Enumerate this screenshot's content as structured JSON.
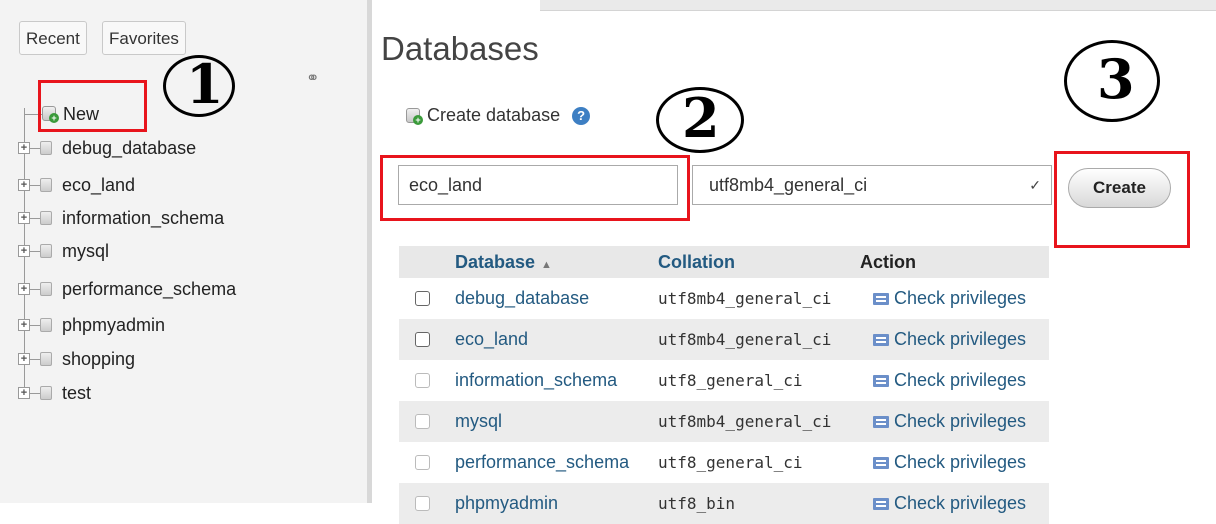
{
  "sidebar": {
    "tabs": [
      "Recent",
      "Favorites"
    ],
    "new_label": "New",
    "databases": [
      "debug_database",
      "eco_land",
      "information_schema",
      "mysql",
      "performance_schema",
      "phpmyadmin",
      "shopping",
      "test"
    ]
  },
  "annotations": [
    "1",
    "2",
    "3"
  ],
  "main": {
    "title": "Databases",
    "create_label": "Create database",
    "db_name_value": "eco_land",
    "collation_value": "utf8mb4_general_ci",
    "create_button": "Create",
    "table": {
      "headers": [
        "Database",
        "Collation",
        "Action"
      ],
      "rows": [
        {
          "name": "debug_database",
          "collation": "utf8mb4_general_ci",
          "action": "Check privileges"
        },
        {
          "name": "eco_land",
          "collation": "utf8mb4_general_ci",
          "action": "Check privileges"
        },
        {
          "name": "information_schema",
          "collation": "utf8_general_ci",
          "action": "Check privileges"
        },
        {
          "name": "mysql",
          "collation": "utf8mb4_general_ci",
          "action": "Check privileges"
        },
        {
          "name": "performance_schema",
          "collation": "utf8_general_ci",
          "action": "Check privileges"
        },
        {
          "name": "phpmyadmin",
          "collation": "utf8_bin",
          "action": "Check privileges"
        }
      ]
    }
  },
  "colors": {
    "annotation_red": "#e8141c",
    "link_blue": "#235a81"
  }
}
